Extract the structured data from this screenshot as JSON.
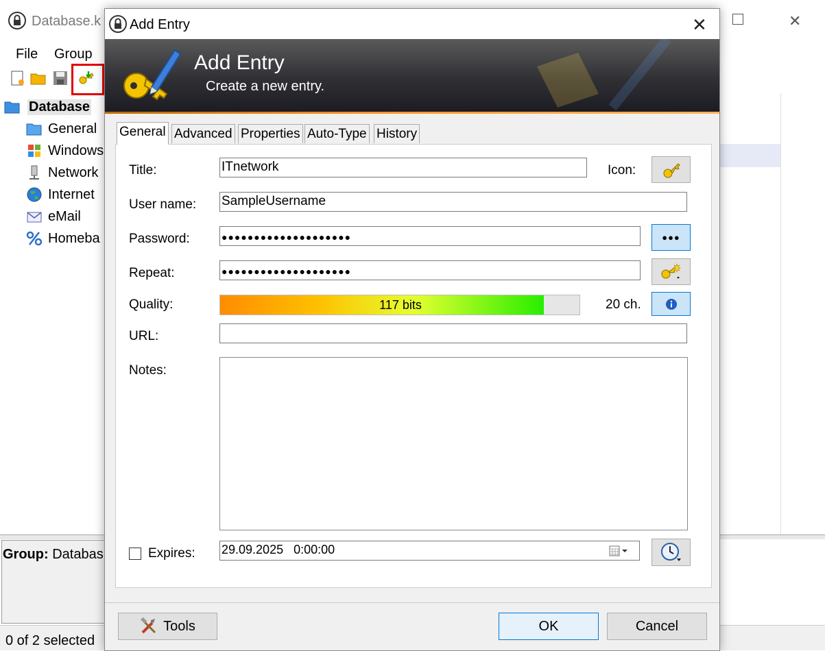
{
  "main_window": {
    "title": "Database.k",
    "menu": [
      "File",
      "Group"
    ],
    "tree": [
      {
        "label": "Database",
        "icon": "folder-open-icon"
      },
      {
        "label": "General",
        "icon": "folder-icon"
      },
      {
        "label": "Windows",
        "icon": "windows-icon"
      },
      {
        "label": "Network",
        "icon": "network-icon"
      },
      {
        "label": "Internet",
        "icon": "globe-icon"
      },
      {
        "label": "eMail",
        "icon": "envelope-icon"
      },
      {
        "label": "Homeba",
        "icon": "percent-icon"
      }
    ],
    "group_label": "Group:",
    "group_value": "Databas",
    "status": "0 of 2 selected"
  },
  "dialog": {
    "title": "Add Entry",
    "banner_title": "Add Entry",
    "banner_subtitle": "Create a new entry.",
    "tabs": [
      "General",
      "Advanced",
      "Properties",
      "Auto-Type",
      "History"
    ],
    "active_tab": "General",
    "fields": {
      "title_label": "Title:",
      "title_value": "ITnetwork",
      "icon_label": "Icon:",
      "username_label": "User name:",
      "username_value": "SampleUsername",
      "password_label": "Password:",
      "password_value": "●●●●●●●●●●●●●●●●●●●●",
      "repeat_label": "Repeat:",
      "repeat_value": "●●●●●●●●●●●●●●●●●●●●",
      "quality_label": "Quality:",
      "quality_text": "117 bits",
      "quality_percent": 90,
      "length_text": "20 ch.",
      "url_label": "URL:",
      "url_value": "",
      "notes_label": "Notes:",
      "notes_value": "",
      "expires_label": "Expires:",
      "expires_value": "29.09.2025   0:00:00",
      "expires_checked": false
    },
    "buttons": {
      "show_password": "●●●",
      "tools": "Tools",
      "ok": "OK",
      "cancel": "Cancel"
    }
  },
  "colors": {
    "highlight_box": "#e00000",
    "banner_dark": "#1b1b22",
    "accent_blue": "#0078d7",
    "quality_start": "#ff8c00",
    "quality_end": "#28ee00"
  }
}
